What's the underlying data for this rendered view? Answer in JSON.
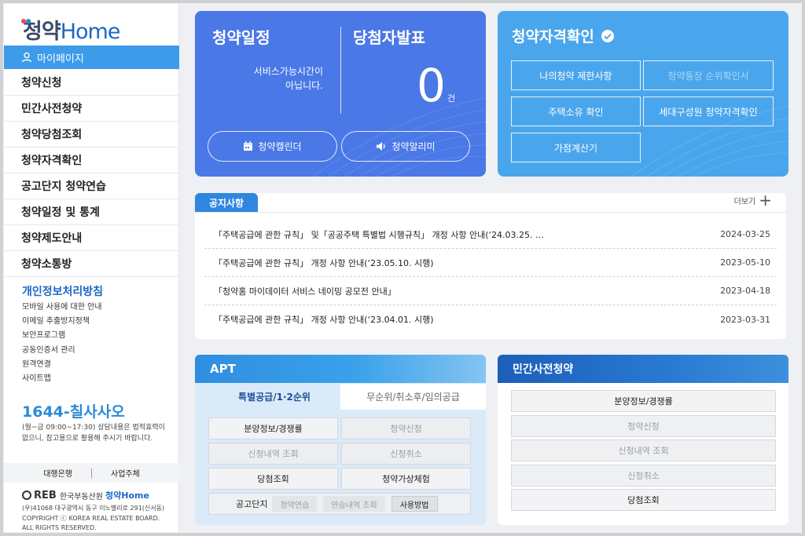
{
  "logo": {
    "prefix": "청약",
    "suffix": "Home"
  },
  "sidebar": {
    "mypage_label": "마이페이지",
    "nav": [
      "청약신청",
      "민간사전청약",
      "청약당첨조회",
      "청약자격확인",
      "공고단지 청약연습",
      "청약일정 및 통계",
      "청약제도안내",
      "청약소통방"
    ],
    "privacy_title": "개인정보처리방침",
    "links": [
      "모바일 사용에 대한 안내",
      "이메일 추출방지정책",
      "보안프로그램",
      "공동인증서 관리",
      "원격연결",
      "사이트맵"
    ],
    "phone": "1644-칠사사오",
    "hours": "(월~금 09:00~17:30) 상담내용은 법적효력이 없으니, 참고용으로 활용해 주시기 바랍니다.",
    "bank_label": "대행은행",
    "provider_label": "사업주체",
    "footer_logo": "REB",
    "footer_org": "한국부동산원",
    "footer_brand": "청약Home",
    "footer_address": "(우)41068 대구광역시 동구 이노밸리로 291(신서동)",
    "footer_copyright": "COPYRIGHT ⓒ KOREA REAL ESTATE BOARD.",
    "footer_rights": "ALL RIGHTS RESERVED."
  },
  "schedule": {
    "title": "청약일정",
    "message_line1": "서비스가능시간이",
    "message_line2": "아닙니다.",
    "calendar_button": "청약캘린더",
    "alert_button": "청약알리미"
  },
  "winners": {
    "title": "당첨자발표",
    "count": "0",
    "unit": "건"
  },
  "eligibility": {
    "title": "청약자격확인",
    "buttons": [
      {
        "label": "나의청약 제한사항",
        "dim": false
      },
      {
        "label": "청약통장 순위확인서",
        "dim": true
      },
      {
        "label": "주택소유 확인",
        "dim": false
      },
      {
        "label": "세대구성원 청약자격확인",
        "dim": false
      },
      {
        "label": "가점계산기",
        "dim": false
      }
    ]
  },
  "notice": {
    "tab": "공지사항",
    "more": "더보기",
    "rows": [
      {
        "title": "「주택공급에 관한 규칙」 및「공공주택 특별법 시행규칙」 개정 사항 안내(‘24.03.25. …",
        "date": "2024-03-25"
      },
      {
        "title": "「주택공급에 관한 규칙」 개정 사항 안내(‘23.05.10. 시행)",
        "date": "2023-05-10"
      },
      {
        "title": "「청약홈 마이데이터 서비스 네이밍 공모전 안내」",
        "date": "2023-04-18"
      },
      {
        "title": "「주택공급에 관한 규칙」 개정 사항 안내(‘23.04.01. 시행)",
        "date": "2023-03-31"
      }
    ]
  },
  "apt": {
    "title": "APT",
    "tab_active": "특별공급/1·2순위",
    "tab_inactive": "무순위/취소후/임의공급",
    "buttons": [
      {
        "label": "분양정보/경쟁률",
        "dim": false
      },
      {
        "label": "청약신청",
        "dim": true
      },
      {
        "label": "신청내역 조회",
        "dim": true
      },
      {
        "label": "신청취소",
        "dim": true
      },
      {
        "label": "당첨조회",
        "dim": false
      },
      {
        "label": "청약가상체험",
        "dim": false
      }
    ],
    "notice_label": "공고단지",
    "notice_buttons": [
      {
        "label": "청약연습",
        "dim": true
      },
      {
        "label": "연습내역 조회",
        "dim": true
      },
      {
        "label": "사용방법",
        "dim": false
      }
    ]
  },
  "private": {
    "title": "민간사전청약",
    "buttons": [
      {
        "label": "분양정보/경쟁률",
        "dim": false
      },
      {
        "label": "청약신청",
        "dim": true
      },
      {
        "label": "신청내역 조회",
        "dim": true
      },
      {
        "label": "신청취소",
        "dim": true
      },
      {
        "label": "당첨조회",
        "dim": false
      }
    ]
  },
  "colors": {
    "schedule_bg": "#4a78e6",
    "eligibility_bg": "#4aa6ec",
    "mypage_bg": "#3d9be9",
    "brand_blue": "#1c67c5"
  }
}
